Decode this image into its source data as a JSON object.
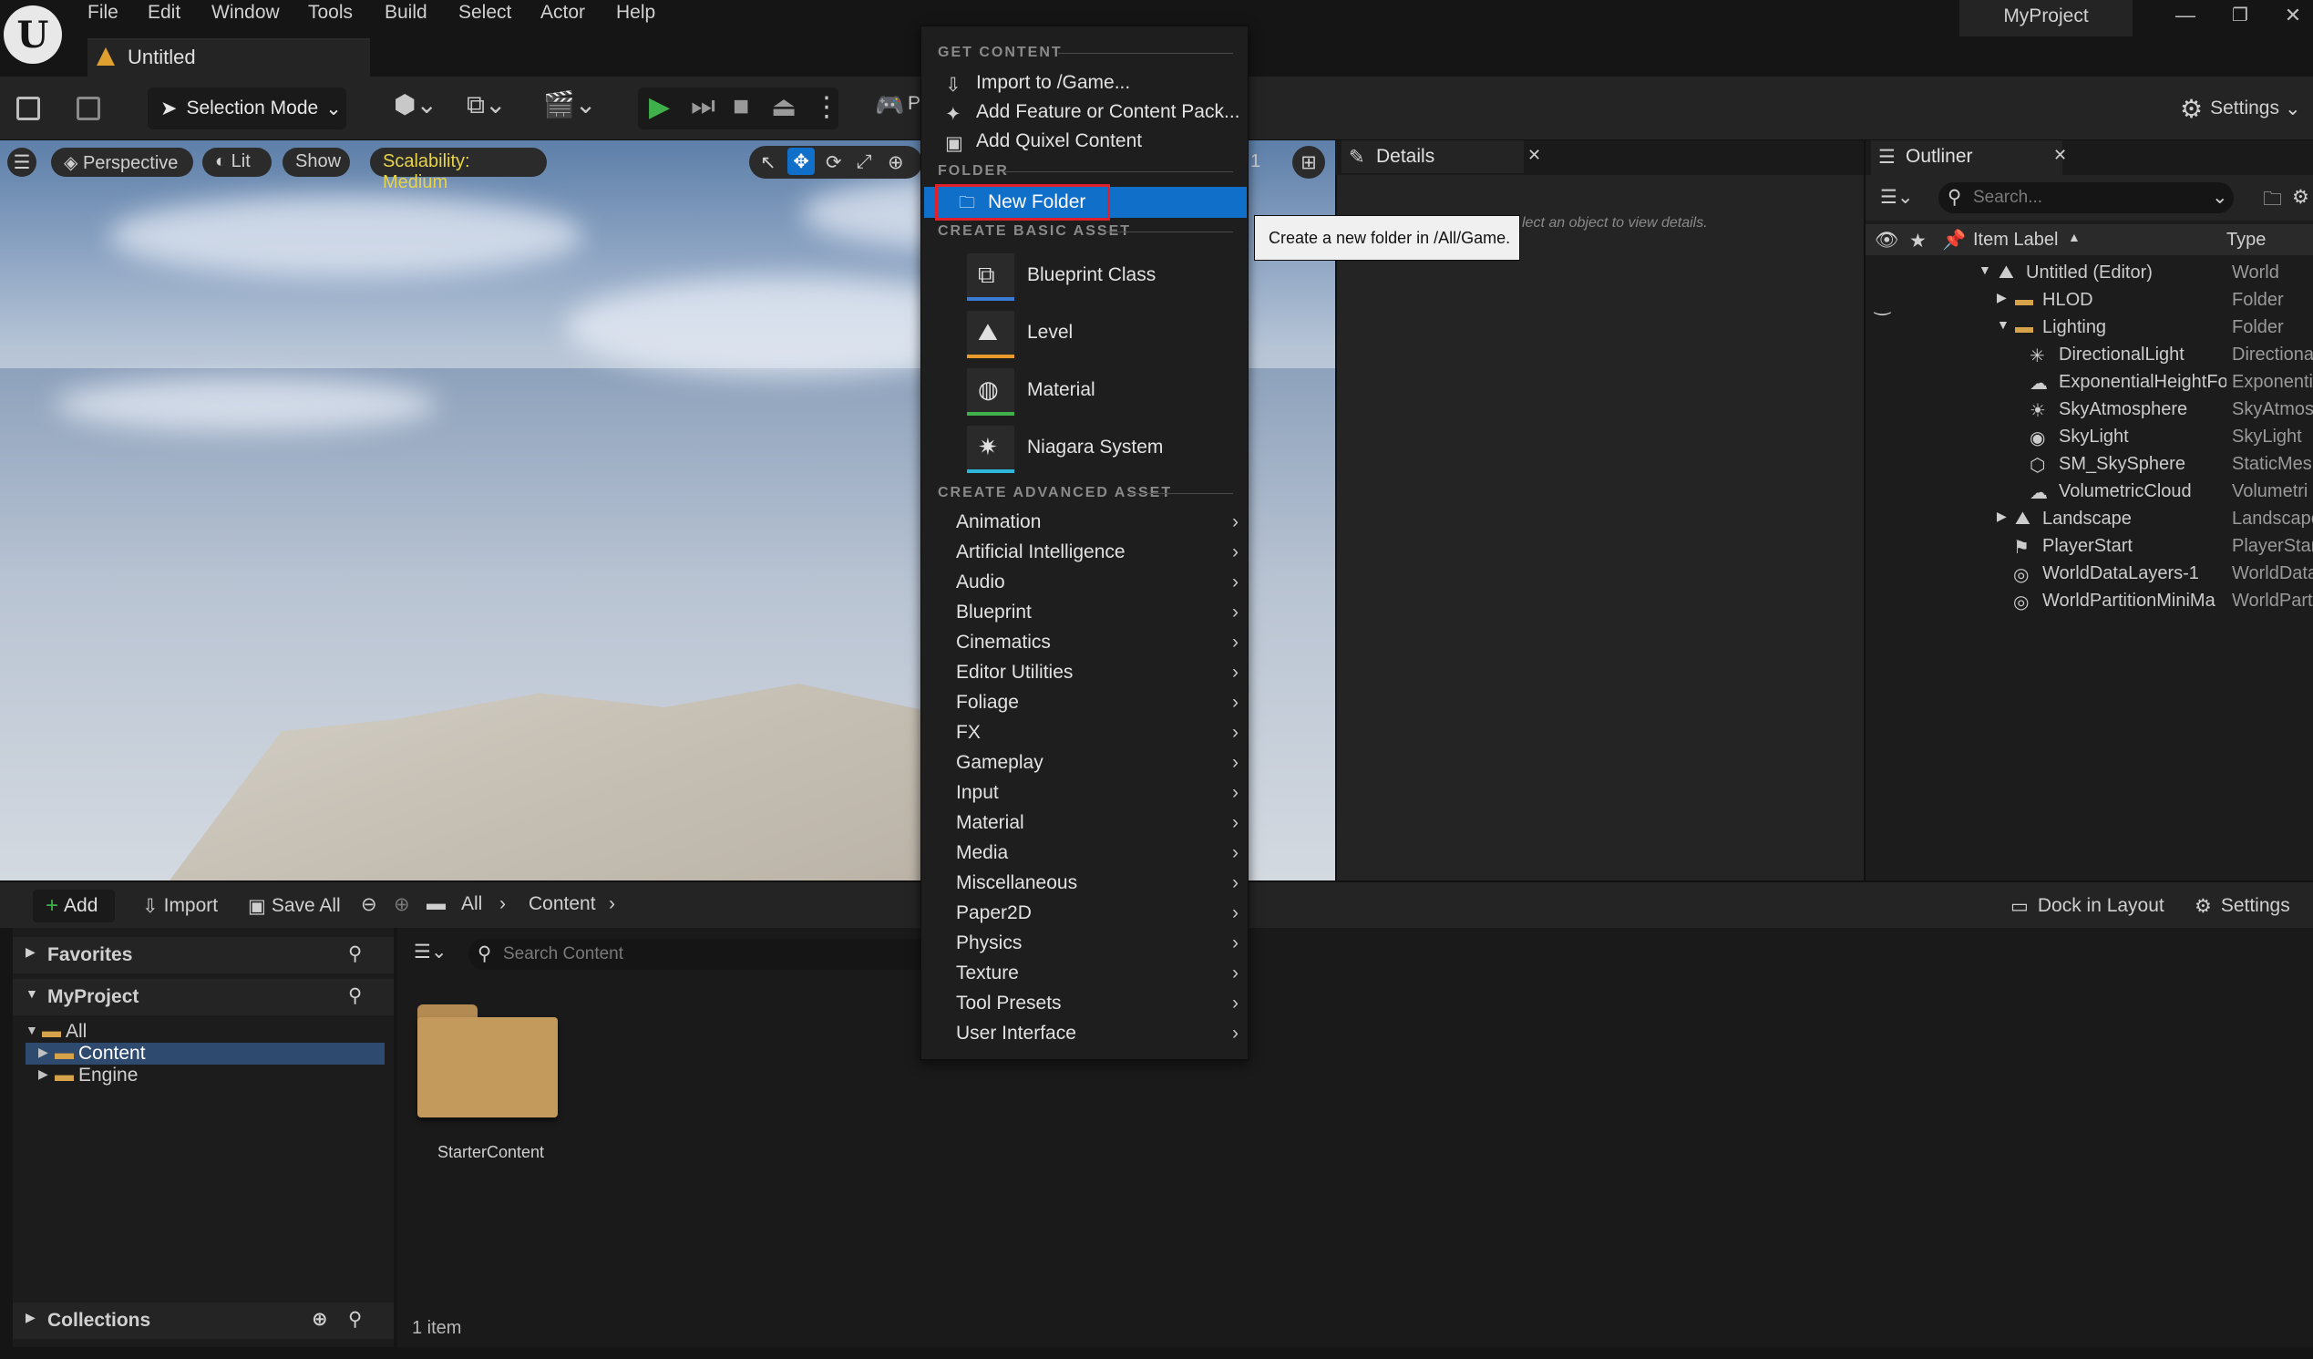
{
  "menubar": {
    "items": [
      "File",
      "Edit",
      "Window",
      "Tools",
      "Build",
      "Select",
      "Actor",
      "Help"
    ],
    "project_name": "MyProject",
    "document_tab": "Untitled"
  },
  "toolbar": {
    "selection_mode": "Selection Mode",
    "settings": "Settings",
    "platforms_partial": "P"
  },
  "viewport": {
    "perspective": "Perspective",
    "lit": "Lit",
    "show": "Show",
    "scalability": "Scalability: Medium",
    "partial_number": "1"
  },
  "details": {
    "tab": "Details",
    "hint": "lect an object to view details."
  },
  "outliner": {
    "tab": "Outliner",
    "search_placeholder": "Search...",
    "col_label": "Item Label",
    "col_type": "Type",
    "rows": [
      {
        "label": "Untitled (Editor)",
        "type": "World"
      },
      {
        "label": "HLOD",
        "type": "Folder"
      },
      {
        "label": "Lighting",
        "type": "Folder"
      },
      {
        "label": "DirectionalLight",
        "type": "Directiona"
      },
      {
        "label": "ExponentialHeightFo",
        "type": "Exponenti"
      },
      {
        "label": "SkyAtmosphere",
        "type": "SkyAtmos"
      },
      {
        "label": "SkyLight",
        "type": "SkyLight"
      },
      {
        "label": "SM_SkySphere",
        "type": "StaticMes"
      },
      {
        "label": "VolumetricCloud",
        "type": "Volumetri"
      },
      {
        "label": "Landscape",
        "type": "Landscape"
      },
      {
        "label": "PlayerStart",
        "type": "PlayerStar"
      },
      {
        "label": "WorldDataLayers-1",
        "type": "WorldData"
      },
      {
        "label": "WorldPartitionMiniMa",
        "type": "WorldPart"
      }
    ]
  },
  "content_browser": {
    "add": "Add",
    "import": "Import",
    "save_all": "Save All",
    "path_all": "All",
    "path_content": "Content",
    "dock_in_layout": "Dock in Layout",
    "settings": "Settings",
    "favorites": "Favorites",
    "project": "MyProject",
    "tree": [
      "All",
      "Content",
      "Engine"
    ],
    "search_placeholder": "Search Content",
    "folder_name": "StarterContent",
    "item_count": "1 item",
    "collections": "Collections"
  },
  "context_menu": {
    "get_content_header": "GET CONTENT",
    "import": "Import to /Game...",
    "add_feature": "Add Feature or Content Pack...",
    "add_quixel": "Add Quixel Content",
    "folder_header": "FOLDER",
    "new_folder": "New Folder",
    "basic_header": "CREATE BASIC ASSET",
    "basic_assets": [
      {
        "label": "Blueprint Class",
        "color": "#3a7bd5"
      },
      {
        "label": "Level",
        "color": "#e89a2a"
      },
      {
        "label": "Material",
        "color": "#3fb04a"
      },
      {
        "label": "Niagara System",
        "color": "#2cb5d8"
      }
    ],
    "advanced_header": "CREATE ADVANCED ASSET",
    "advanced_assets": [
      "Animation",
      "Artificial Intelligence",
      "Audio",
      "Blueprint",
      "Cinematics",
      "Editor Utilities",
      "Foliage",
      "FX",
      "Gameplay",
      "Input",
      "Material",
      "Media",
      "Miscellaneous",
      "Paper2D",
      "Physics",
      "Texture",
      "Tool Presets",
      "User Interface"
    ]
  },
  "tooltip": "Create a new folder in /All/Game.",
  "colors": {
    "accent_blue": "#0f6fc9",
    "highlight_outline": "#e0202a",
    "play_green": "#3fb04a",
    "scalability_yellow": "#e8d34a"
  }
}
